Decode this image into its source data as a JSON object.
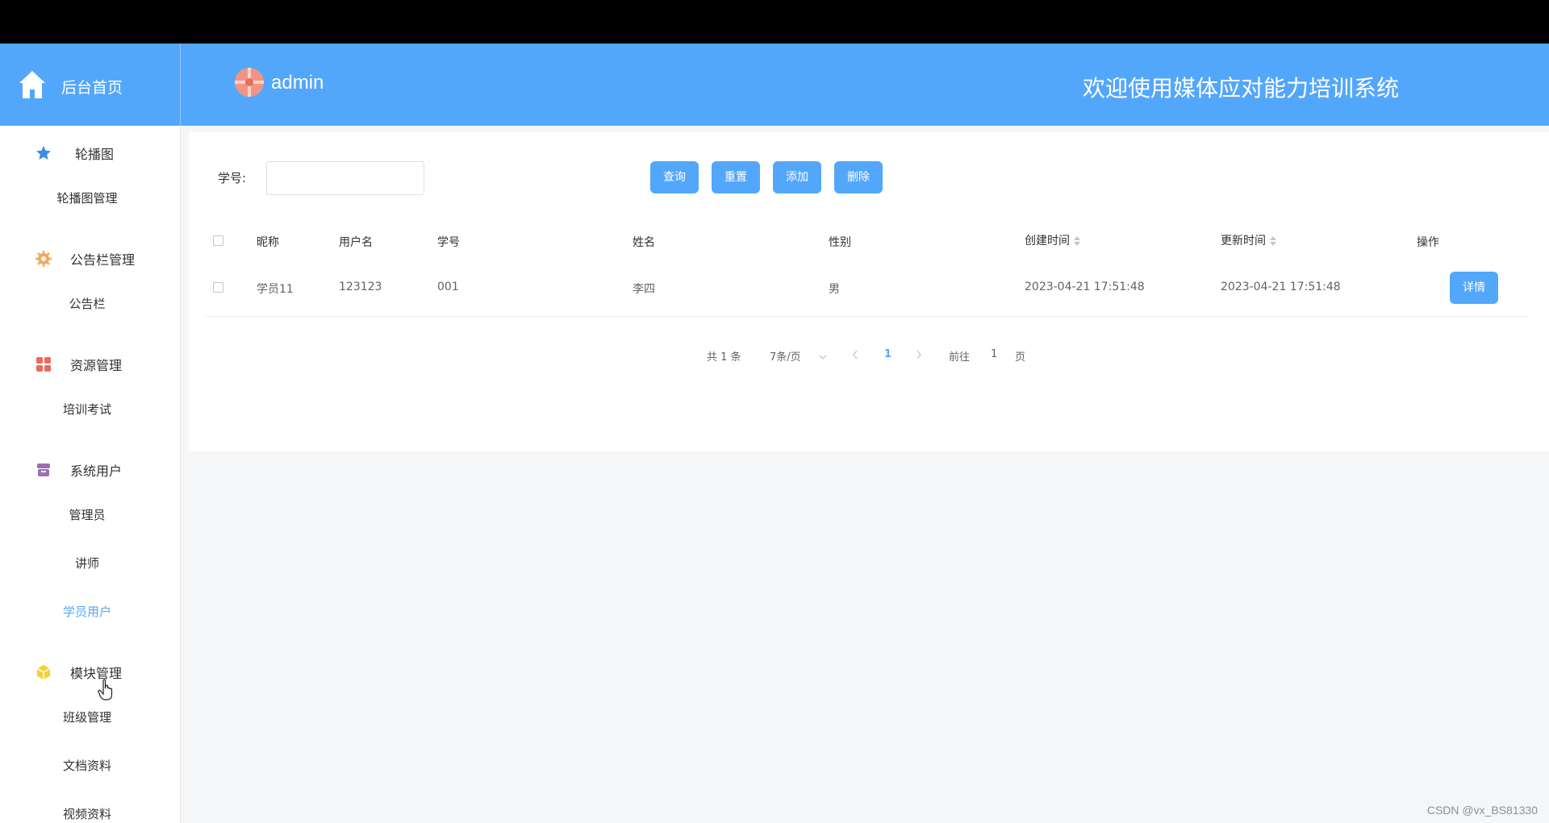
{
  "header": {
    "brand_label": "后台首页",
    "username": "admin",
    "system_title": "欢迎使用媒体应对能力培训系统",
    "accent_color": "#53a7fa"
  },
  "sidebar": {
    "groups": [
      {
        "label": "轮播图",
        "icon": "star-icon",
        "items": [
          {
            "label": "轮播图管理"
          }
        ]
      },
      {
        "label": "公告栏管理",
        "icon": "gear-icon",
        "items": [
          {
            "label": "公告栏"
          }
        ]
      },
      {
        "label": "资源管理",
        "icon": "grid-icon",
        "items": [
          {
            "label": "培训考试"
          }
        ]
      },
      {
        "label": "系统用户",
        "icon": "archive-icon",
        "items": [
          {
            "label": "管理员"
          },
          {
            "label": "讲师"
          },
          {
            "label": "学员用户",
            "active": true
          }
        ]
      },
      {
        "label": "模块管理",
        "icon": "cube-icon",
        "items": [
          {
            "label": "班级管理"
          },
          {
            "label": "文档资料"
          },
          {
            "label": "视频资料"
          }
        ]
      }
    ]
  },
  "search": {
    "label": "学号:",
    "value": "",
    "buttons": {
      "query": "查询",
      "reset": "重置",
      "add": "添加",
      "delete": "删除"
    }
  },
  "table": {
    "columns": [
      "昵称",
      "用户名",
      "学号",
      "姓名",
      "性别",
      "创建时间",
      "更新时间",
      "操作"
    ],
    "rows": [
      {
        "nickname": "学员11",
        "username": "123123",
        "student_no": "001",
        "name": "李四",
        "gender": "男",
        "created": "2023-04-21 17:51:48",
        "updated": "2023-04-21 17:51:48",
        "action": "详情"
      }
    ]
  },
  "pagination": {
    "total": "共 1 条",
    "page_size": "7条/页",
    "current_page": "1",
    "goto_label": "前往",
    "goto_value": "1",
    "page_unit": "页"
  },
  "watermark": "CSDN @vx_BS81330"
}
